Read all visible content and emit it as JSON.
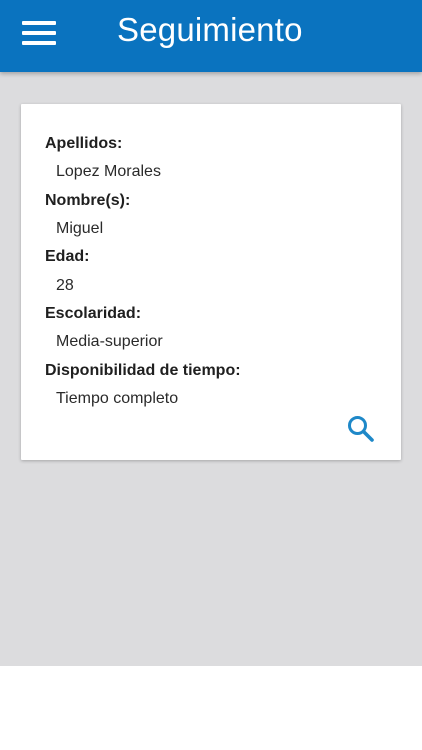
{
  "appbar": {
    "title": "Seguimiento",
    "menu_icon": "hamburger-menu-icon"
  },
  "profile": {
    "fields": [
      {
        "label": "Apellidos:",
        "value": "Lopez Morales"
      },
      {
        "label": "Nombre(s):",
        "value": "Miguel"
      },
      {
        "label": "Edad:",
        "value": "28"
      },
      {
        "label": "Escolaridad:",
        "value": "Media-superior"
      },
      {
        "label": "Disponibilidad de tiempo:",
        "value": "Tiempo completo"
      }
    ],
    "action_icon": "search-icon"
  },
  "colors": {
    "primary": "#0a73bf",
    "background": "#dcdcde",
    "card": "#ffffff",
    "accent_icon": "#1e88c8"
  }
}
